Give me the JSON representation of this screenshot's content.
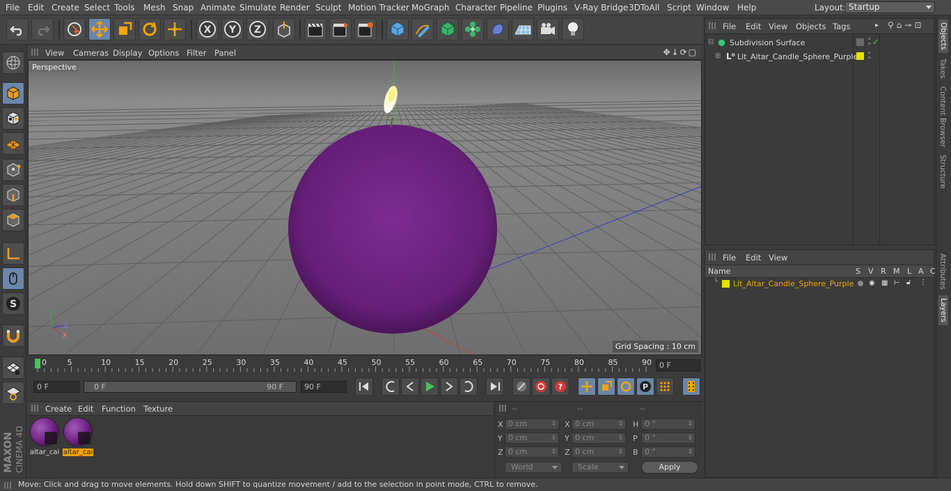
{
  "menubar": {
    "items": [
      "File",
      "Edit",
      "Create",
      "Select",
      "Tools",
      "Mesh",
      "Snap",
      "Animate",
      "Simulate",
      "Render",
      "Sculpt",
      "Motion Tracker",
      "MoGraph",
      "Character",
      "Pipeline",
      "Plugins",
      "V-Ray Bridge",
      "3DToAll",
      "Script",
      "Window",
      "Help"
    ],
    "layout_label": "Layout:",
    "layout_value": "Startup"
  },
  "viewport": {
    "menu": [
      "View",
      "Cameras",
      "Display",
      "Options",
      "Filter",
      "Panel"
    ],
    "camera_label": "Perspective",
    "grid_spacing": "Grid Spacing : 10 cm",
    "axis_labels": {
      "y": "Y",
      "z": "Z",
      "x": "X"
    }
  },
  "timeline": {
    "ticks": [
      "0",
      "5",
      "10",
      "15",
      "20",
      "25",
      "30",
      "35",
      "40",
      "45",
      "50",
      "55",
      "60",
      "65",
      "70",
      "75",
      "80",
      "85",
      "90"
    ],
    "current_frame": "0 F"
  },
  "transport": {
    "start_field": "0 F",
    "range_start": "0 F",
    "range_end": "90 F",
    "end_field": "90 F"
  },
  "material_manager": {
    "menu": [
      "Create",
      "Edit",
      "Function",
      "Texture"
    ],
    "materials": [
      {
        "label": "altar_cai",
        "selected": false
      },
      {
        "label": "altar_cai",
        "selected": true
      }
    ]
  },
  "coordinates": {
    "headers": [
      "--",
      "--",
      "--"
    ],
    "rows": [
      {
        "pos_label": "X",
        "pos_value": "0 cm",
        "size_label": "X",
        "size_value": "0 cm",
        "rot_label": "H",
        "rot_value": "0 °"
      },
      {
        "pos_label": "Y",
        "pos_value": "0 cm",
        "size_label": "Y",
        "size_value": "0 cm",
        "rot_label": "P",
        "rot_value": "0 °"
      },
      {
        "pos_label": "Z",
        "pos_value": "0 cm",
        "size_label": "Z",
        "size_value": "0 cm",
        "rot_label": "B",
        "rot_value": "0 °"
      }
    ],
    "mode_dropdown": "World",
    "scale_dropdown": "Scale",
    "apply_label": "Apply"
  },
  "object_manager": {
    "menu": [
      "File",
      "Edit",
      "View",
      "Objects",
      "Tags"
    ],
    "objects": [
      {
        "name": "Subdivision Surface",
        "level": 0
      },
      {
        "name": "Lit_Altar_Candle_Sphere_Purple",
        "level": 1
      }
    ]
  },
  "layer_manager": {
    "menu": [
      "File",
      "Edit",
      "View"
    ],
    "columns": [
      "Name",
      "S",
      "V",
      "R",
      "M",
      "L",
      "A",
      "C"
    ],
    "layers": [
      {
        "name": "Lit_Altar_Candle_Sphere_Purple",
        "color": "#e8e000"
      }
    ]
  },
  "side_tabs": [
    "Objects",
    "Takes",
    "Content Browser",
    "Structure",
    "Attributes",
    "Layers"
  ],
  "status_text": "Move: Click and drag to move elements. Hold down SHIFT to quantize movement / add to the selection in point mode, CTRL to remove.",
  "branding": {
    "line1": "MAXON",
    "line2": "CINEMA 4D"
  },
  "colors": {
    "accent": "#6a86aa",
    "sphere": "#6a1f7d",
    "highlight": "#ffa200",
    "layer_text": "#f0a800"
  }
}
